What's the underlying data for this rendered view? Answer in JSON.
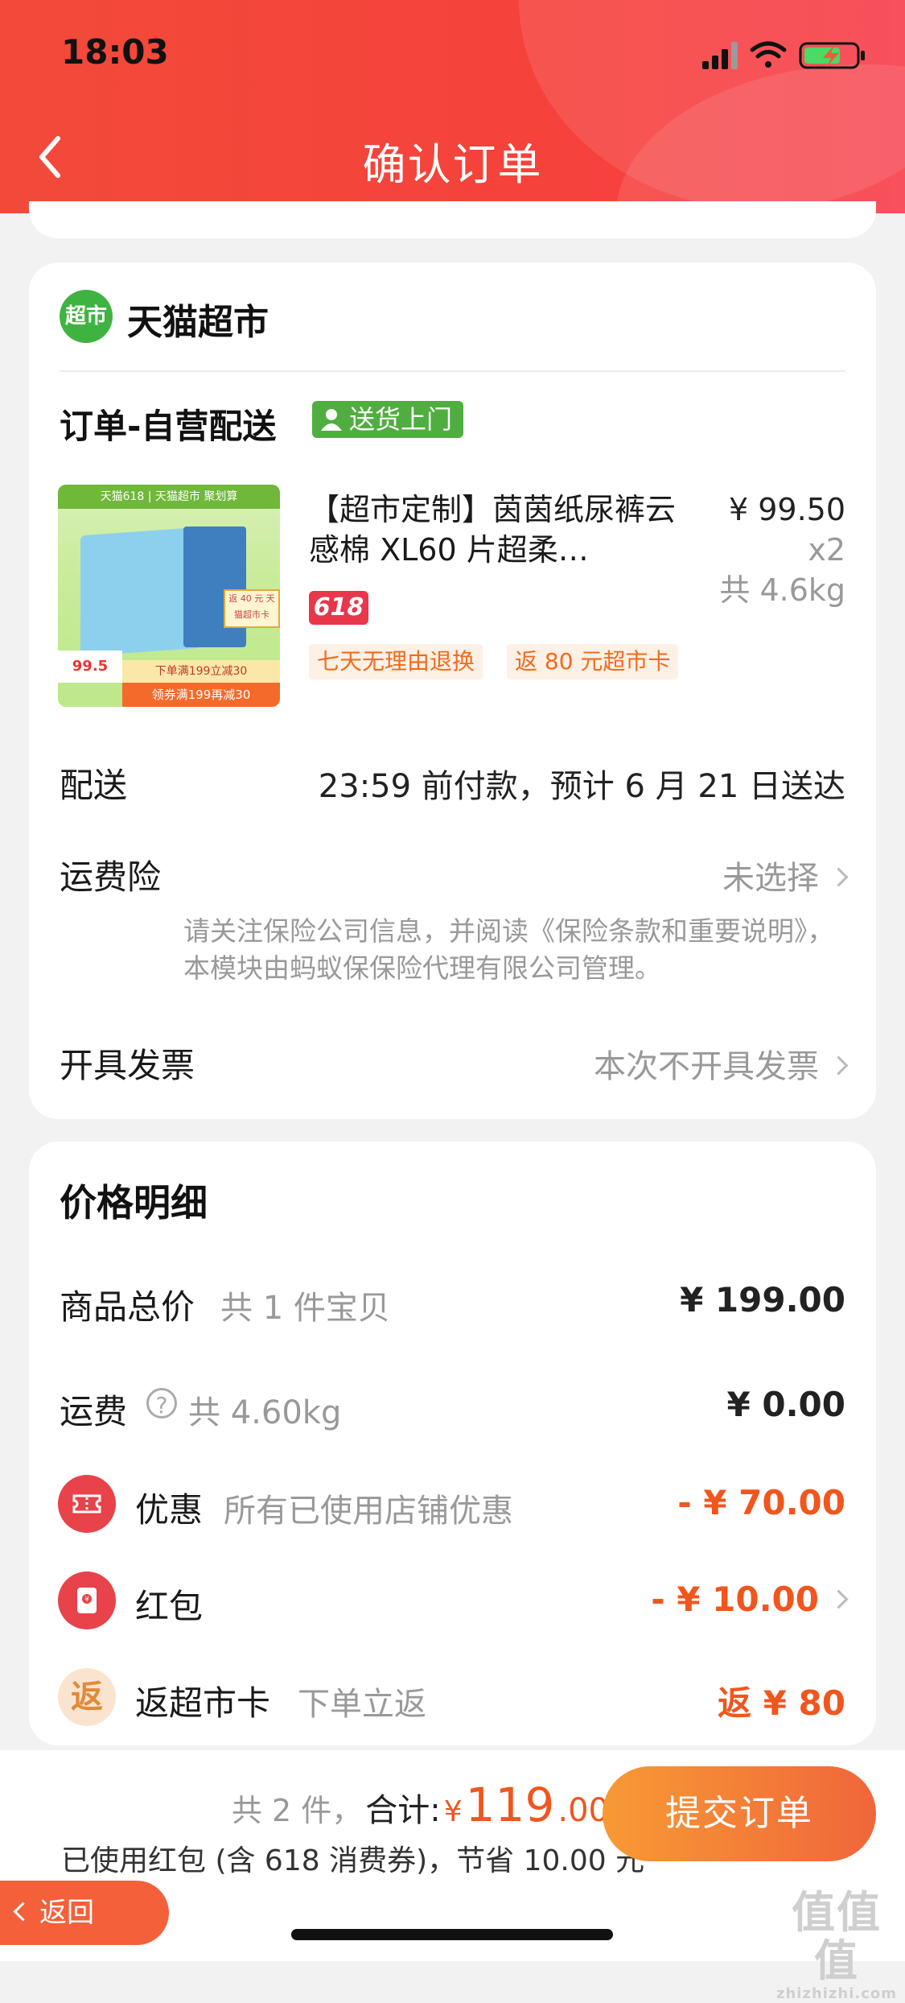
{
  "status_bar": {
    "time": "18:03"
  },
  "header": {
    "title": "确认订单"
  },
  "shop": {
    "logo_text": "超市",
    "name": "天猫超市"
  },
  "order": {
    "type": "订单-自营配送",
    "delivery_badge": "送货上门"
  },
  "product": {
    "title": "【超市定制】茵茵纸尿裤云感棉 XL60 片超柔…",
    "price": "¥ 99.50",
    "qty": "x2",
    "weight": "共 4.6kg",
    "promo_tag": "618",
    "service_tags": [
      "七天无理由退换",
      "返 80 元超市卡"
    ],
    "image": {
      "top_banner": "天猫618 | 天猫超市 聚划算",
      "return_card": "返 40 元 天猫超市卡",
      "price": "99.5",
      "coupon_line": "下单满199立减30",
      "coupon_line2": "领券满199再减30"
    }
  },
  "rows": {
    "delivery_label": "配送",
    "delivery_value": "23:59 前付款，预计 6 月 21 日送达",
    "insurance_label": "运费险",
    "insurance_value": "未选择",
    "insurance_note": "请关注保险公司信息，并阅读《保险条款和重要说明》，本模块由蚂蚁保保险代理有限公司管理。",
    "invoice_label": "开具发票",
    "invoice_value": "本次不开具发票"
  },
  "price_detail": {
    "title": "价格明细",
    "goods_label": "商品总价",
    "goods_sub": "共 1 件宝贝",
    "goods_value": "¥ 199.00",
    "shipping_label": "运费",
    "shipping_sub": "共 4.60kg",
    "shipping_value": "¥ 0.00",
    "discount_label": "优惠",
    "discount_sub": "所有已使用店铺优惠",
    "discount_value": "- ¥ 70.00",
    "redpacket_label": "红包",
    "redpacket_value": "- ¥ 10.00",
    "return_icon": "返",
    "return_label": "返超市卡",
    "return_sub": "下单立返",
    "return_value": "返 ¥ 80"
  },
  "bottom": {
    "count": "共 2 件，",
    "total_label": "合计:",
    "yen": "¥",
    "total_int": "119",
    "total_dec": ".00",
    "savings": "已使用红包 (含 618 消费券)，节省 10.00 元",
    "submit": "提交订单",
    "return_btn": "返回"
  },
  "watermark": {
    "main": "值值值",
    "sub": "zhizhizhi.com"
  },
  "colors": {
    "header_red": "#f5423b",
    "accent_orange": "#f0561d",
    "green": "#4fae3f"
  },
  "icons": [
    "back-icon",
    "signal-icon",
    "wifi-icon",
    "battery-icon",
    "person-icon",
    "chevron-right-icon",
    "discount-ticket-icon",
    "red-packet-icon",
    "help-icon"
  ]
}
